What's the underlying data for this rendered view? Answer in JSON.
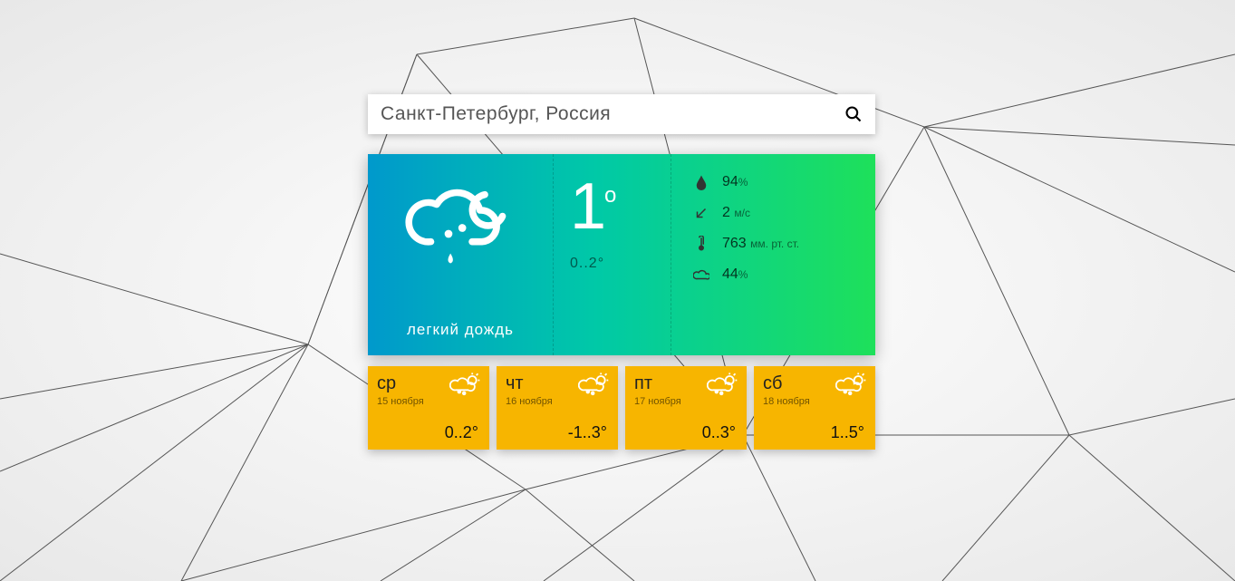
{
  "search": {
    "value": "Санкт-Петербург, Россия"
  },
  "current": {
    "condition": "легкий дождь",
    "temp": "1",
    "range": "0..2°",
    "humidity": "94",
    "humidity_unit": "%",
    "wind": "2",
    "wind_unit": "м/с",
    "pressure": "763",
    "pressure_unit": "мм. рт. ст.",
    "clouds": "44",
    "clouds_unit": "%"
  },
  "forecast": [
    {
      "day": "ср",
      "date": "15 ноября",
      "temp": "0..2°"
    },
    {
      "day": "чт",
      "date": "16 ноября",
      "temp": "-1..3°"
    },
    {
      "day": "пт",
      "date": "17 ноября",
      "temp": "0..3°"
    },
    {
      "day": "сб",
      "date": "18 ноября",
      "temp": "1..5°"
    }
  ]
}
